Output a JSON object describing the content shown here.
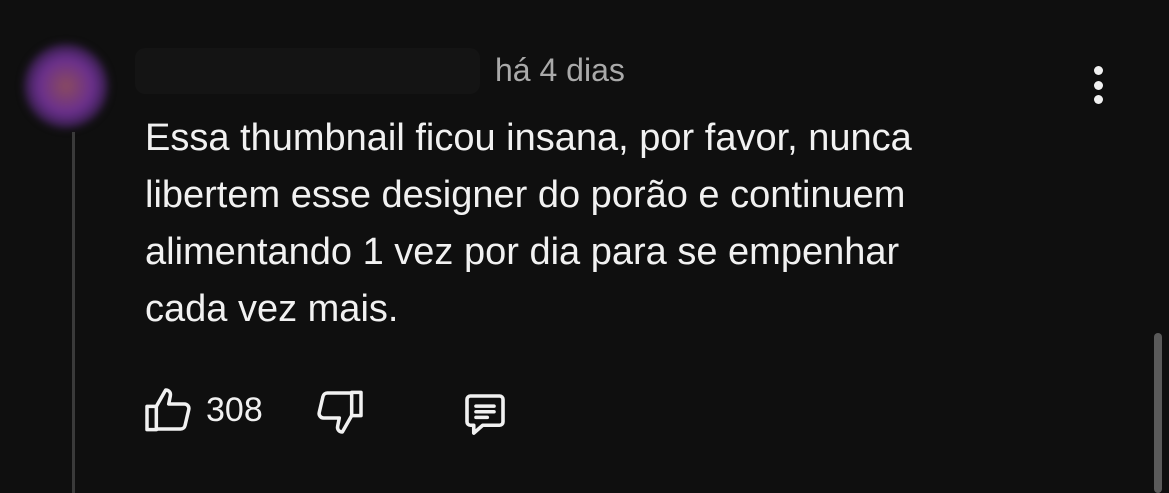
{
  "comment": {
    "timestamp": "há 4 dias",
    "text_lines": [
      "Essa thumbnail ficou insana, por favor, nunca",
      "libertem esse designer do porão e continuem",
      "alimentando 1 vez por dia para se empenhar",
      "cada vez mais."
    ],
    "like_count": "308"
  },
  "icons": {
    "avatar": "avatar-blurred",
    "more": "more-vertical-icon",
    "like": "thumbs-up-icon",
    "dislike": "thumbs-down-icon",
    "reply": "comment-icon"
  },
  "colors": {
    "background": "#0f0f0f",
    "text": "#f1f1f1",
    "secondary_text": "#aaaaaa"
  }
}
